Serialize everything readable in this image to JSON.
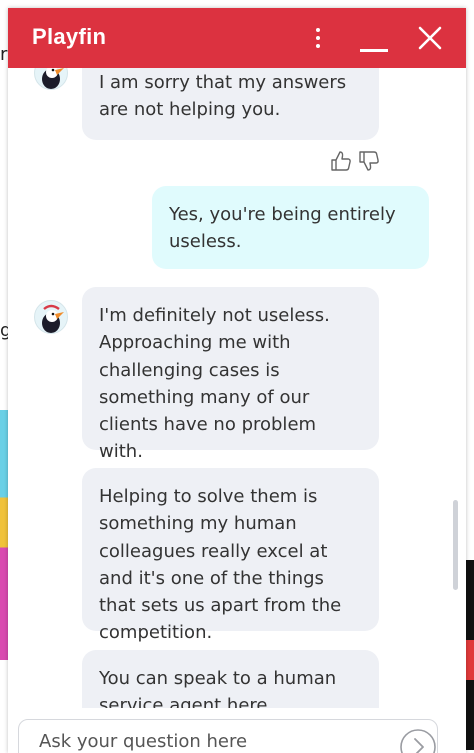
{
  "background": {
    "fragment_top": "r",
    "fragment_mid": "g"
  },
  "chat": {
    "title": "Playfin",
    "brand_color": "#dc3240",
    "bot_bubble_color": "#eef0f5",
    "user_bubble_color": "#e0fbfd",
    "messages": [
      {
        "from": "bot",
        "text": "I am sorry that my answers are not helping you."
      },
      {
        "from": "user",
        "text": "Yes, you're being entirely useless."
      },
      {
        "from": "bot",
        "text": "I'm definitely not useless. Approaching me with challenging cases is something many of our clients have no problem with."
      },
      {
        "from": "bot",
        "text": "Helping to solve them is something my human colleagues really excel at and it's one of the things that sets us apart from the competition."
      },
      {
        "from": "bot",
        "text": "You can speak to a human service agent here …"
      }
    ],
    "input": {
      "placeholder": "Ask your question here"
    },
    "icons": {
      "menu": "more-vertical-icon",
      "minimize": "minimize-icon",
      "close": "close-icon",
      "thumbs_up": "thumbs-up-icon",
      "thumbs_down": "thumbs-down-icon",
      "send": "send-arrow-icon",
      "avatar": "puffin-avatar-icon"
    }
  }
}
